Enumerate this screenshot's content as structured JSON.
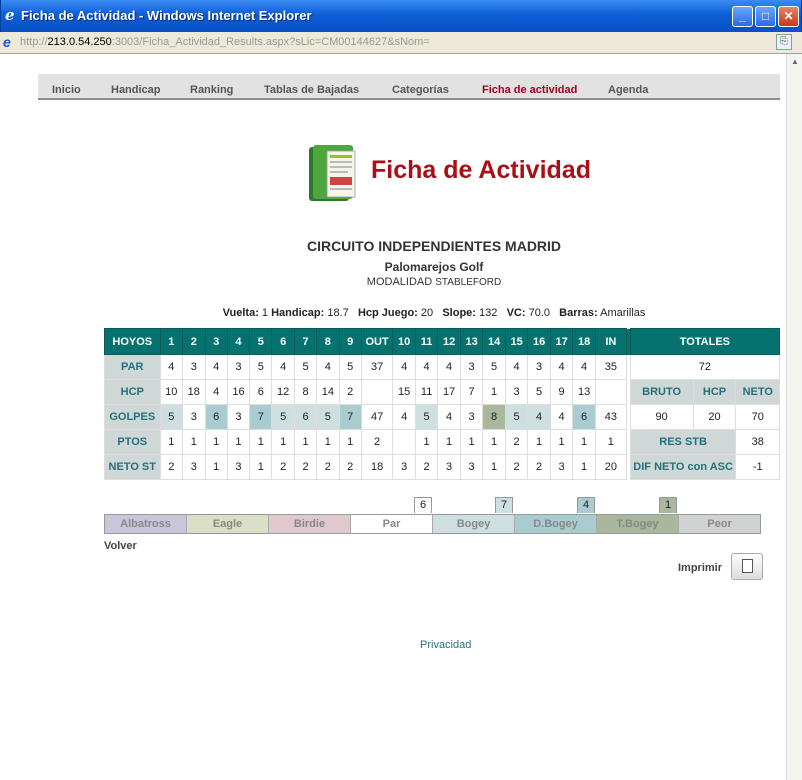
{
  "window": {
    "title": "Ficha de Actividad - Windows Internet Explorer",
    "url_host": "213.0.54.250",
    "url_rest": ":3003/Ficha_Actividad_Results.aspx?sLic=CM00144627&sNom="
  },
  "nav": [
    "Inicio",
    "Handicap",
    "Ranking",
    "Tablas de Bajadas",
    "Categorías",
    "Ficha de actividad",
    "Agenda"
  ],
  "logo": {
    "title": "Ficha de Actividad"
  },
  "event": {
    "circuit": "CIRCUITO INDEPENDIENTES MADRID",
    "course": "Palomarejos Golf",
    "modality_label": "MODALIDAD",
    "modality": "STABLEFORD"
  },
  "info": {
    "vuelta_label": "Vuelta:",
    "vuelta": "1",
    "handicap_label": "Handicap:",
    "handicap": "18.7",
    "hcp_juego_label": "Hcp Juego:",
    "hcp_juego": "20",
    "slope_label": "Slope:",
    "slope": "132",
    "vc_label": "VC:",
    "vc": "70.0",
    "barras_label": "Barras:",
    "barras": "Amarillas"
  },
  "scorecard": {
    "header": [
      "HOYOS",
      "1",
      "2",
      "3",
      "4",
      "5",
      "6",
      "7",
      "8",
      "9",
      "OUT",
      "10",
      "11",
      "12",
      "13",
      "14",
      "15",
      "16",
      "17",
      "18",
      "IN"
    ],
    "rows": [
      {
        "label": "PAR",
        "cells": [
          "4",
          "3",
          "4",
          "3",
          "5",
          "4",
          "5",
          "4",
          "5",
          "37",
          "4",
          "4",
          "4",
          "3",
          "5",
          "4",
          "3",
          "4",
          "4",
          "35"
        ]
      },
      {
        "label": "HCP",
        "cells": [
          "10",
          "18",
          "4",
          "16",
          "6",
          "12",
          "8",
          "14",
          "2",
          "",
          "15",
          "11",
          "17",
          "7",
          "1",
          "3",
          "5",
          "9",
          "13",
          ""
        ]
      },
      {
        "label": "GOLPES",
        "cells": [
          "5",
          "3",
          "6",
          "3",
          "7",
          "5",
          "6",
          "5",
          "7",
          "47",
          "4",
          "5",
          "4",
          "3",
          "8",
          "5",
          "4",
          "4",
          "6",
          "43"
        ]
      },
      {
        "label": "PTOS",
        "cells": [
          "1",
          "1",
          "1",
          "1",
          "1",
          "1",
          "1",
          "1",
          "1",
          "2",
          "",
          "1",
          "1",
          "1",
          "1",
          "2",
          "1",
          "1",
          "1",
          "1"
        ]
      },
      {
        "label": "NETO ST",
        "cells": [
          "2",
          "3",
          "1",
          "3",
          "1",
          "2",
          "2",
          "2",
          "2",
          "18",
          "3",
          "2",
          "3",
          "3",
          "1",
          "2",
          "2",
          "3",
          "1",
          "20"
        ]
      }
    ],
    "totales": {
      "header": "TOTALES",
      "par_total": "72",
      "sub_labels": [
        "BRUTO",
        "HCP",
        "NETO"
      ],
      "sub_values": [
        "90",
        "20",
        "70"
      ],
      "res_stb_label": "RES STB",
      "res_stb": "38",
      "dif_label": "DIF NETO con ASC",
      "dif": "-1"
    }
  },
  "legend": {
    "items": [
      "Albatross",
      "Eagle",
      "Birdie",
      "Par",
      "Bogey",
      "D.Bogey",
      "T.Bogey",
      "Peor"
    ],
    "counts": {
      "par": "6",
      "bogey": "7",
      "dbogey": "4",
      "tbogey": "1"
    },
    "colors": [
      "#c8c6d8",
      "#dcdfc8",
      "#dfc9cd",
      "#ffffff",
      "#cddfe1",
      "#a9ccd1",
      "#a9b89c",
      "#cfd3d3"
    ]
  },
  "links": {
    "volver": "Volver",
    "imprimir": "Imprimir",
    "privacidad": "Privacidad"
  }
}
